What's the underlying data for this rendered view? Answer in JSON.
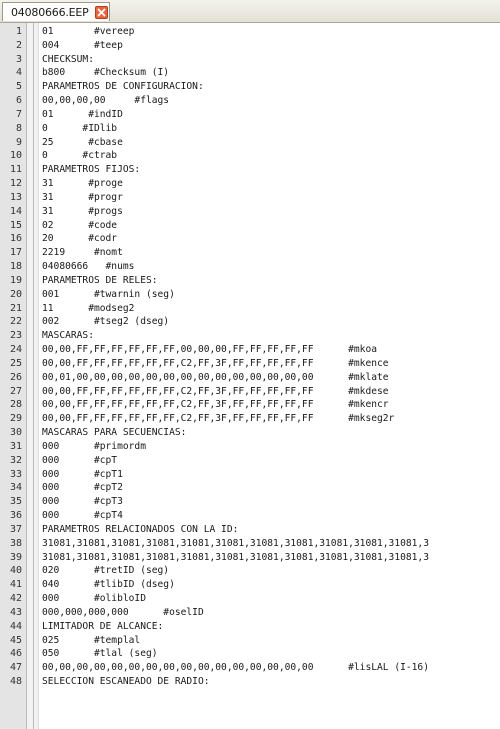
{
  "tab": {
    "filename": "04080666.EEP",
    "close_icon": "close-icon"
  },
  "editor": {
    "lines": [
      {
        "num": "1",
        "text": "01       #vereep"
      },
      {
        "num": "2",
        "text": "004      #teep"
      },
      {
        "num": "3",
        "text": "CHECKSUM:"
      },
      {
        "num": "4",
        "text": "b800     #Checksum (I)"
      },
      {
        "num": "5",
        "text": "PARAMETROS DE CONFIGURACION:"
      },
      {
        "num": "6",
        "text": "00,00,00,00     #flags"
      },
      {
        "num": "7",
        "text": "01      #indID"
      },
      {
        "num": "8",
        "text": "0      #IDlib"
      },
      {
        "num": "9",
        "text": "25      #cbase"
      },
      {
        "num": "10",
        "text": "0      #ctrab"
      },
      {
        "num": "11",
        "text": "PARAMETROS FIJOS:"
      },
      {
        "num": "12",
        "text": "31      #proge"
      },
      {
        "num": "13",
        "text": "31      #progr"
      },
      {
        "num": "14",
        "text": "31      #progs"
      },
      {
        "num": "15",
        "text": "02      #code"
      },
      {
        "num": "16",
        "text": "20      #codr"
      },
      {
        "num": "17",
        "text": "2219     #nomt"
      },
      {
        "num": "18",
        "text": "04080666   #nums"
      },
      {
        "num": "19",
        "text": "PARAMETROS DE RELES:"
      },
      {
        "num": "20",
        "text": "001      #twarnin (seg)"
      },
      {
        "num": "21",
        "text": "11      #modseg2"
      },
      {
        "num": "22",
        "text": "002      #tseg2 (dseg)"
      },
      {
        "num": "23",
        "text": "MASCARAS:"
      },
      {
        "num": "24",
        "text": "00,00,FF,FF,FF,FF,FF,FF,00,00,00,FF,FF,FF,FF,FF      #mkoa"
      },
      {
        "num": "25",
        "text": "00,00,FF,FF,FF,FF,FF,FF,C2,FF,3F,FF,FF,FF,FF,FF      #mkence"
      },
      {
        "num": "26",
        "text": "00,01,00,00,00,00,00,00,00,00,00,00,00,00,00,00      #mklate"
      },
      {
        "num": "27",
        "text": "00,00,FF,FF,FF,FF,FF,FF,C2,FF,3F,FF,FF,FF,FF,FF      #mkdese"
      },
      {
        "num": "28",
        "text": "00,00,FF,FF,FF,FF,FF,FF,C2,FF,3F,FF,FF,FF,FF,FF      #mkencr"
      },
      {
        "num": "29",
        "text": "00,00,FF,FF,FF,FF,FF,FF,C2,FF,3F,FF,FF,FF,FF,FF      #mkseg2r"
      },
      {
        "num": "30",
        "text": "MASCARAS PARA SECUENCIAS:"
      },
      {
        "num": "31",
        "text": "000      #primordm"
      },
      {
        "num": "32",
        "text": "000      #cpT"
      },
      {
        "num": "33",
        "text": "000      #cpT1"
      },
      {
        "num": "34",
        "text": "000      #cpT2"
      },
      {
        "num": "35",
        "text": "000      #cpT3"
      },
      {
        "num": "36",
        "text": "000      #cpT4"
      },
      {
        "num": "37",
        "text": "PARAMETROS RELACIONADOS CON LA ID:"
      },
      {
        "num": "38",
        "text": "31081,31081,31081,31081,31081,31081,31081,31081,31081,31081,31081,3"
      },
      {
        "num": "39",
        "text": "31081,31081,31081,31081,31081,31081,31081,31081,31081,31081,31081,3"
      },
      {
        "num": "40",
        "text": "020      #tretID (seg)"
      },
      {
        "num": "41",
        "text": "040      #tlibID (dseg)"
      },
      {
        "num": "42",
        "text": "000      #olibloID"
      },
      {
        "num": "43",
        "text": "000,000,000,000      #oselID"
      },
      {
        "num": "44",
        "text": "LIMITADOR DE ALCANCE:"
      },
      {
        "num": "45",
        "text": "025      #templal"
      },
      {
        "num": "46",
        "text": "050      #tlal (seg)"
      },
      {
        "num": "47",
        "text": "00,00,00,00,00,00,00,00,00,00,00,00,00,00,00,00      #lisLAL (I-16)"
      },
      {
        "num": "48",
        "text": "SELECCION ESCANEADO DE RADIO:"
      }
    ]
  },
  "colors": {
    "tab_close": "#e8663d",
    "gutter": "#e4e4e4",
    "background": "#ffffff"
  }
}
